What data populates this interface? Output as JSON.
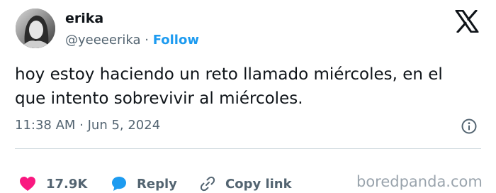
{
  "author": {
    "name": "erika",
    "handle": "@yeeeerika",
    "separator": "·",
    "follow_label": "Follow"
  },
  "tweet": {
    "text": "hoy estoy haciendo un reto llamado miércoles, en el\nque intento sobrevivir al miércoles.",
    "timestamp": "11:38 AM · Jun 5, 2024"
  },
  "actions": {
    "likes": "17.9K",
    "reply_label": "Reply",
    "copy_link_label": "Copy link"
  },
  "watermark": "boredpanda.com",
  "icons": {
    "logo": "x-logo-icon",
    "info": "info-icon",
    "like": "heart-icon",
    "reply": "reply-bubble-icon",
    "copy_link": "link-icon"
  },
  "colors": {
    "follow": "#1d9bf0",
    "heart": "#f91880",
    "muted_text": "#536471",
    "primary_text": "#0f1419"
  }
}
